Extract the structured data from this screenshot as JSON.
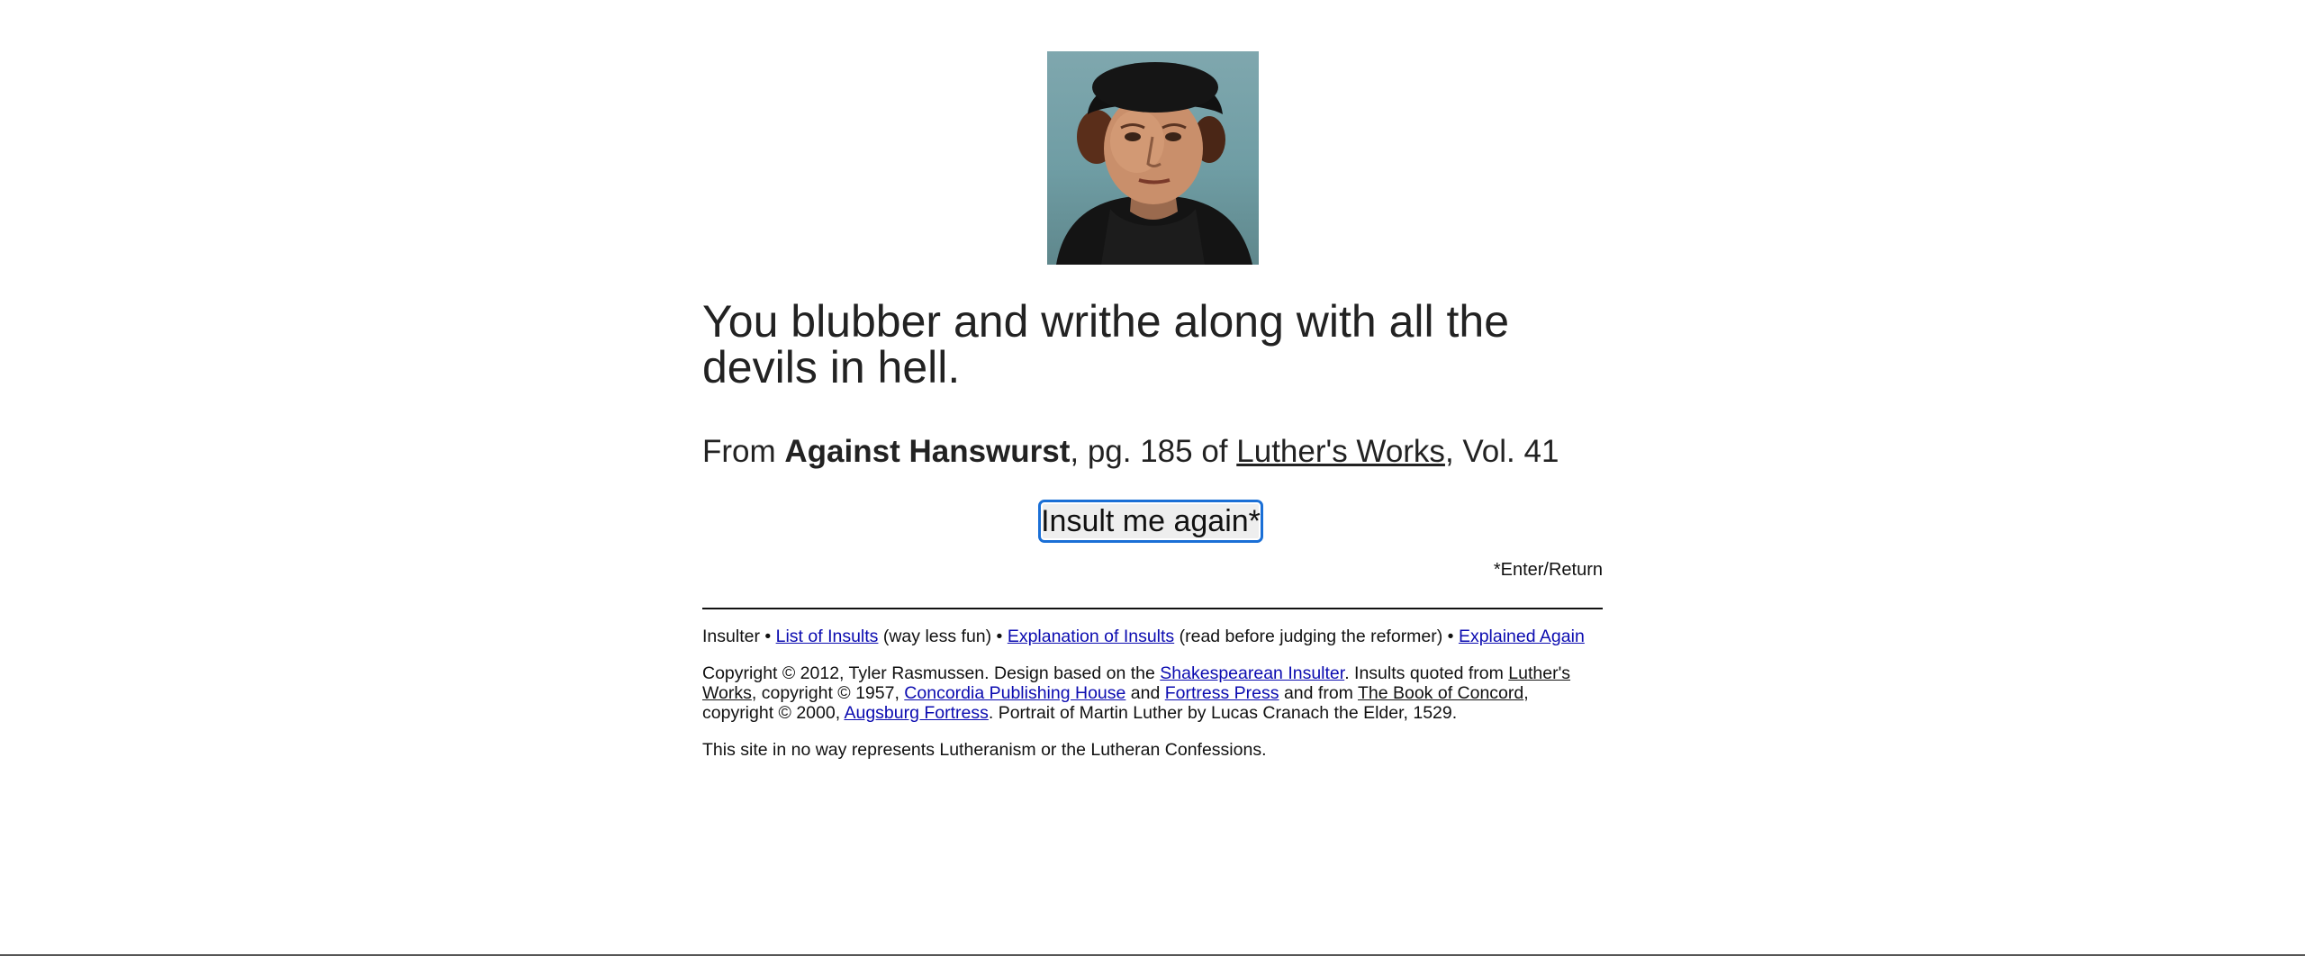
{
  "portrait": {
    "alt": "Portrait of Martin Luther"
  },
  "insult": {
    "text": "You blubber and writhe along with all the devils in hell."
  },
  "source": {
    "prefix": "From",
    "work": "Against Hanswurst",
    "page_text": ", pg. 185 of",
    "collection": "Luther's Works",
    "volume_text": ", Vol. 41"
  },
  "button": {
    "label": "Insult me again*"
  },
  "hint": {
    "text": "*Enter/Return"
  },
  "footer": {
    "nav": {
      "home": "Insulter",
      "sep": " • ",
      "list_link": "List of Insults",
      "list_note": " (way less fun)",
      "explanation_link": "Explanation of Insults",
      "explanation_note": " (read before judging the reformer)",
      "explained_again_link": "Explained Again"
    },
    "copyright": {
      "t1": "Copyright © 2012, Tyler Rasmussen. Design based on the ",
      "shakespeare_link": "Shakespearean Insulter",
      "t2": ". Insults quoted from ",
      "luthers_works": "Luther's Works",
      "t3": ", copyright © 1957, ",
      "concordia_link": "Concordia Publishing House",
      "t4": " and ",
      "fortress_link": "Fortress Press",
      "t5": " and from ",
      "book_of_concord": "The Book of Concord",
      "t6": ", copyright © 2000, ",
      "augsburg_link": "Augsburg Fortress",
      "t7": ". Portrait of Martin Luther by Lucas Cranach the Elder, 1529."
    },
    "disclaimer": "This site in no way represents Lutheranism or the Lutheran Confessions."
  },
  "colors": {
    "link": "#0b0bb0",
    "button_focus": "#1a6fd6",
    "portrait_background": "#7fa7ae"
  }
}
